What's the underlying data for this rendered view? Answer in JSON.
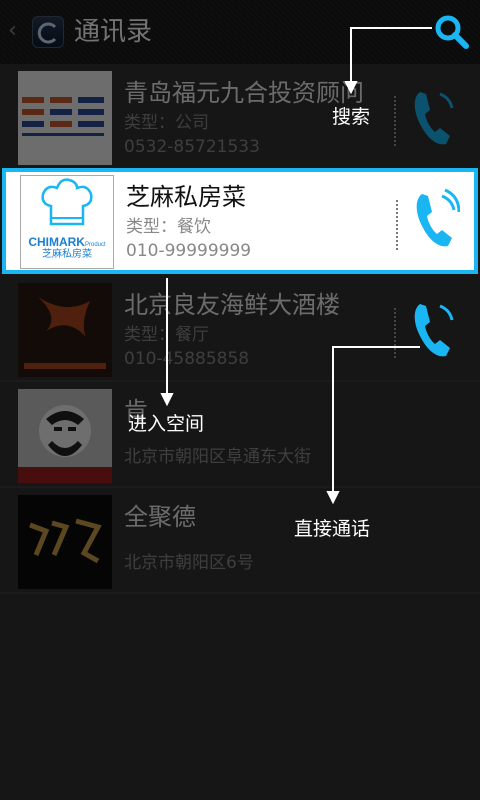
{
  "app": {
    "title": "通讯录"
  },
  "contacts": [
    {
      "name": "青岛福元九合投资顾问",
      "type": "类型：公司",
      "phone": "0532-85721533"
    },
    {
      "name": "芝麻私房菜",
      "type": "类型：餐饮",
      "phone": "010-99999999",
      "thumb_text_en": "CHIMARK",
      "thumb_text_small": "Product",
      "thumb_text_cn": "芝麻私房菜"
    },
    {
      "name": "北京良友海鲜大酒楼",
      "type": "类型：餐厅",
      "phone": "010-45885858"
    },
    {
      "name": "肯",
      "address": "北京市朝阳区阜通东大街"
    },
    {
      "name": "全聚德",
      "address": "北京市朝阳区6号"
    }
  ],
  "callouts": {
    "search": "搜索",
    "enter_space": "进入空间",
    "direct_call": "直接通话"
  },
  "colors": {
    "accent": "#1ab6f4",
    "background": "#313131",
    "topbar": "#1a1a1a"
  }
}
